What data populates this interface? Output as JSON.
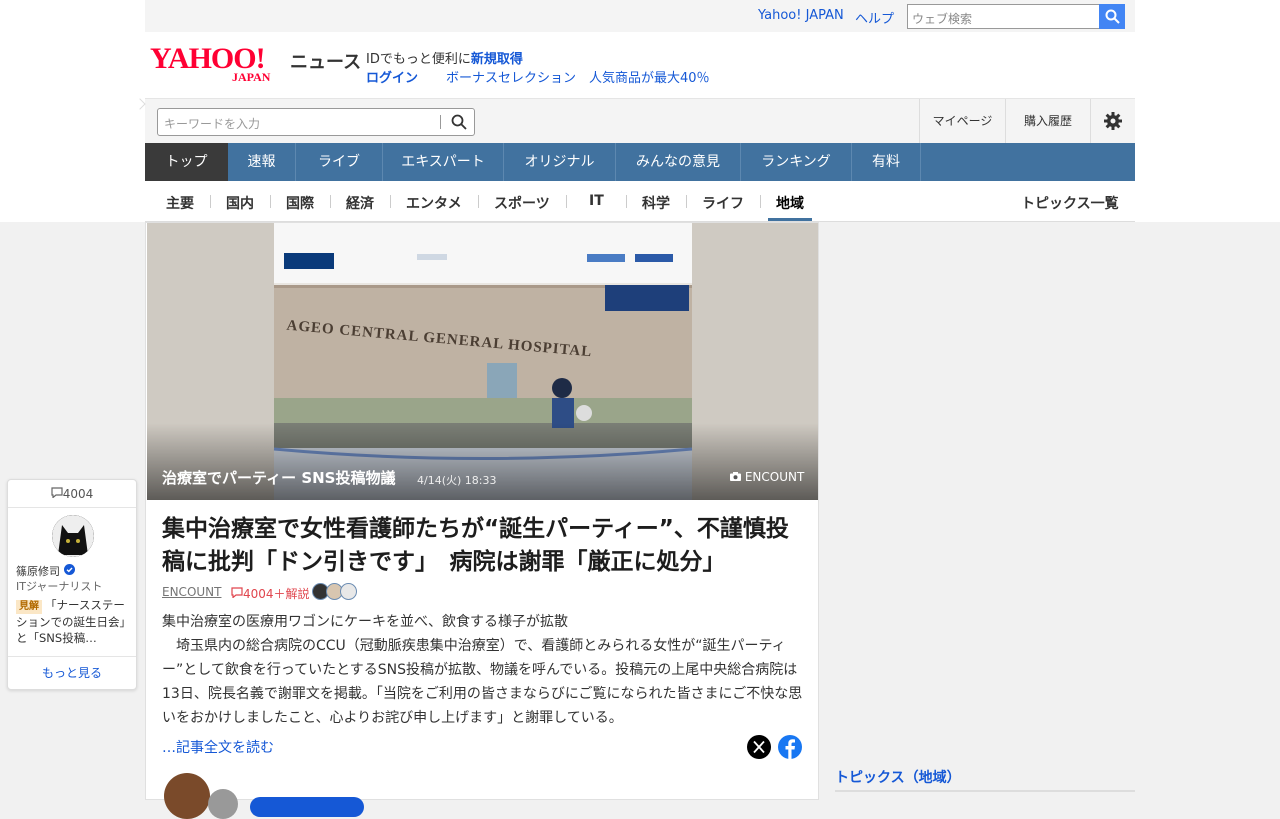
{
  "util": {
    "yahoo_japan": "Yahoo! JAPAN",
    "help": "ヘルプ",
    "web_search_placeholder": "ウェブ検索"
  },
  "header": {
    "logo_main": "YAHOO!",
    "logo_sub": "JAPAN",
    "service": "ニュース",
    "id_text": "IDでもっと便利に",
    "id_link": "新規取得",
    "login": "ログイン",
    "promo": "ボーナスセレクション　人気商品が最大40％"
  },
  "search": {
    "placeholder": "キーワードを入力",
    "mypage": "マイページ",
    "history": "購入履歴"
  },
  "main_nav": [
    "トップ",
    "速報",
    "ライブ",
    "エキスパート",
    "オリジナル",
    "みんなの意見",
    "ランキング",
    "有料"
  ],
  "sub_nav": [
    "主要",
    "国内",
    "国際",
    "経済",
    "エンタメ",
    "スポーツ",
    "IT",
    "科学",
    "ライフ",
    "地域"
  ],
  "sub_nav_active": "地域",
  "topics_all": "トピックス一覧",
  "article": {
    "hero_caption": "治療室でパーティー SNS投稿物議",
    "hero_date": "4/14(火) 18:33",
    "hero_source": "ENCOUNT",
    "hero_sign": "AGEO CENTRAL GENERAL HOSPITAL",
    "headline": "集中治療室で女性看護師たちが“誕生パーティー”、不謹慎投稿に批判「ドン引きです」　病院は謝罪「厳正に処分」",
    "source": "ENCOUNT",
    "comments": "4004＋解説",
    "lead": "集中治療室の医療用ワゴンにケーキを並べ、飲食する様子が拡散",
    "body": "　埼玉県内の総合病院のCCU（冠動脈疾患集中治療室）で、看護師とみられる女性が“誕生パーティー”として飲食を行っていたとするSNS投稿が拡散、物議を呼んでいる。投稿元の上尾中央総合病院は13日、院長名義で謝罪文を掲載。「当院をご利用の皆さまならびにご覧になられた皆さまにご不快な思いをおかけしましたこと、心よりお詫び申し上げます」と謝罪している。",
    "read_more": "…記事全文を読む"
  },
  "side_comment": {
    "count": "4004",
    "name": "篠原修司",
    "title": "ITジャーナリスト",
    "badge": "見解",
    "text": "「ナースステーションでの誕生日会」と「SNS投稿…",
    "more": "もっと見る"
  },
  "right": {
    "topics_title": "トピックス（地域）"
  },
  "colors": {
    "nav_bg": "#41729f",
    "link": "#1558d6",
    "logo": "#ff0033",
    "comment": "#e0454d"
  }
}
